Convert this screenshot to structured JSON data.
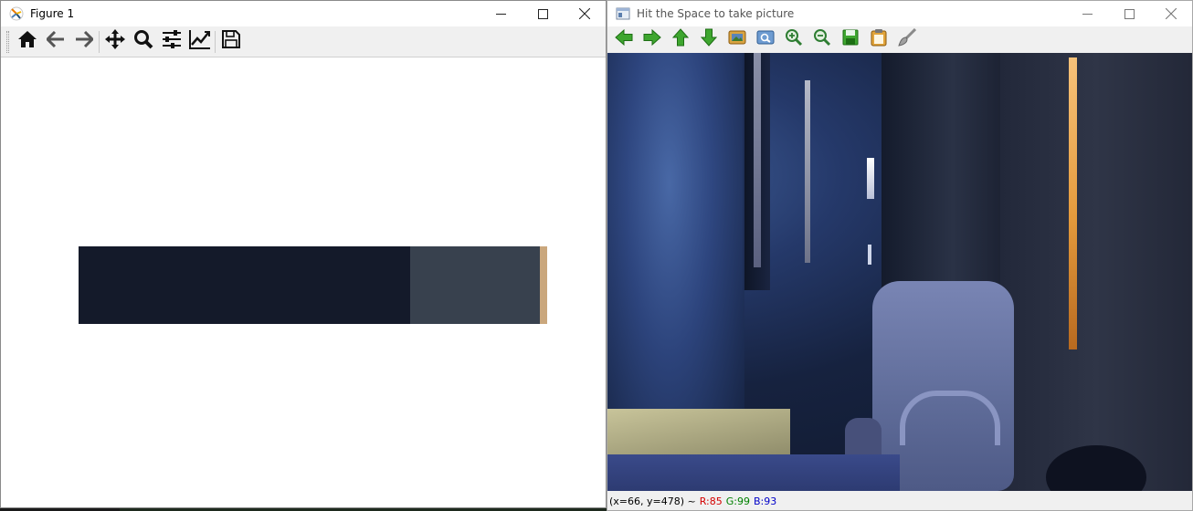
{
  "left_window": {
    "title": "Figure 1",
    "title_icon": "matplotlib-logo-icon",
    "controls": [
      "minimize-icon",
      "maximize-icon",
      "close-icon"
    ],
    "toolbar": [
      {
        "name": "home-button",
        "icon": "home-icon"
      },
      {
        "name": "back-button",
        "icon": "arrow-left-icon"
      },
      {
        "name": "forward-button",
        "icon": "arrow-right-icon"
      },
      {
        "name": "pan-button",
        "icon": "move-icon"
      },
      {
        "name": "zoom-button",
        "icon": "magnifier-icon"
      },
      {
        "name": "subplots-button",
        "icon": "sliders-icon"
      },
      {
        "name": "edit-axes-button",
        "icon": "line-chart-icon"
      },
      {
        "name": "save-button",
        "icon": "floppy-disk-icon"
      }
    ],
    "palette": [
      {
        "color": "#141a2a",
        "fraction": 0.708
      },
      {
        "color": "#38414e",
        "fraction": 0.276
      },
      {
        "color": "#caa77d",
        "fraction": 0.016
      }
    ]
  },
  "right_window": {
    "title": "Hit the Space to take picture",
    "title_icon": "opencv-window-icon",
    "controls": [
      "minimize-icon",
      "maximize-icon",
      "close-icon"
    ],
    "toolbar": [
      {
        "name": "pan-left-button",
        "icon": "green-arrow-left-icon"
      },
      {
        "name": "pan-right-button",
        "icon": "green-arrow-right-icon"
      },
      {
        "name": "pan-up-button",
        "icon": "green-arrow-up-icon"
      },
      {
        "name": "pan-down-button",
        "icon": "green-arrow-down-icon"
      },
      {
        "name": "zoom-original-button",
        "icon": "image-icon"
      },
      {
        "name": "zoom-fit-button",
        "icon": "fit-screen-icon"
      },
      {
        "name": "zoom-in-button",
        "icon": "zoom-in-icon"
      },
      {
        "name": "zoom-out-button",
        "icon": "zoom-out-icon"
      },
      {
        "name": "save-image-button",
        "icon": "save-icon"
      },
      {
        "name": "copy-image-button",
        "icon": "clipboard-icon"
      },
      {
        "name": "properties-button",
        "icon": "brush-icon"
      }
    ],
    "status": {
      "coords": "(x=66, y=478) ~",
      "r": "R:85",
      "g": "G:99",
      "b": "B:93"
    }
  }
}
